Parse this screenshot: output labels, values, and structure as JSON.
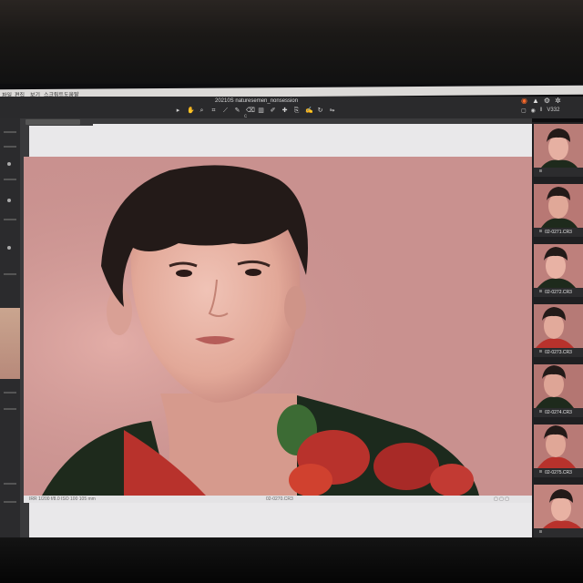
{
  "menu": {
    "items": [
      "파일",
      "편집",
      "보기",
      "스크립트",
      "도움말"
    ]
  },
  "window": {
    "title": "20210S naturesemen_nonsession"
  },
  "toolbar": {
    "tools": [
      "select-tool",
      "hand-tool",
      "zoom-tool",
      "crop-tool",
      "straighten-tool",
      "brush-tool",
      "eraser-tool",
      "gradient-tool",
      "color-picker-tool",
      "heal-tool",
      "clone-tool",
      "annotate-tool",
      "rotate-tool",
      "flip-tool"
    ],
    "sync_indicator": "c"
  },
  "right_controls": {
    "version": "V332"
  },
  "statusbar": {
    "left": "IRR 1/200   f/8.0   ISO 100   105 mm",
    "center": "02-0270.CR3"
  },
  "filmstrip": {
    "labels": [
      "",
      "02-0271.CR3",
      "02-0272.CR3",
      "02-0273.CR3",
      "02-0274.CR3",
      "02-0275.CR3",
      ""
    ]
  },
  "colors": {
    "background": "#cc9896",
    "shirt_red": "#b8322c",
    "shirt_green": "#1e3a22",
    "accent": "#ff6a2a"
  }
}
